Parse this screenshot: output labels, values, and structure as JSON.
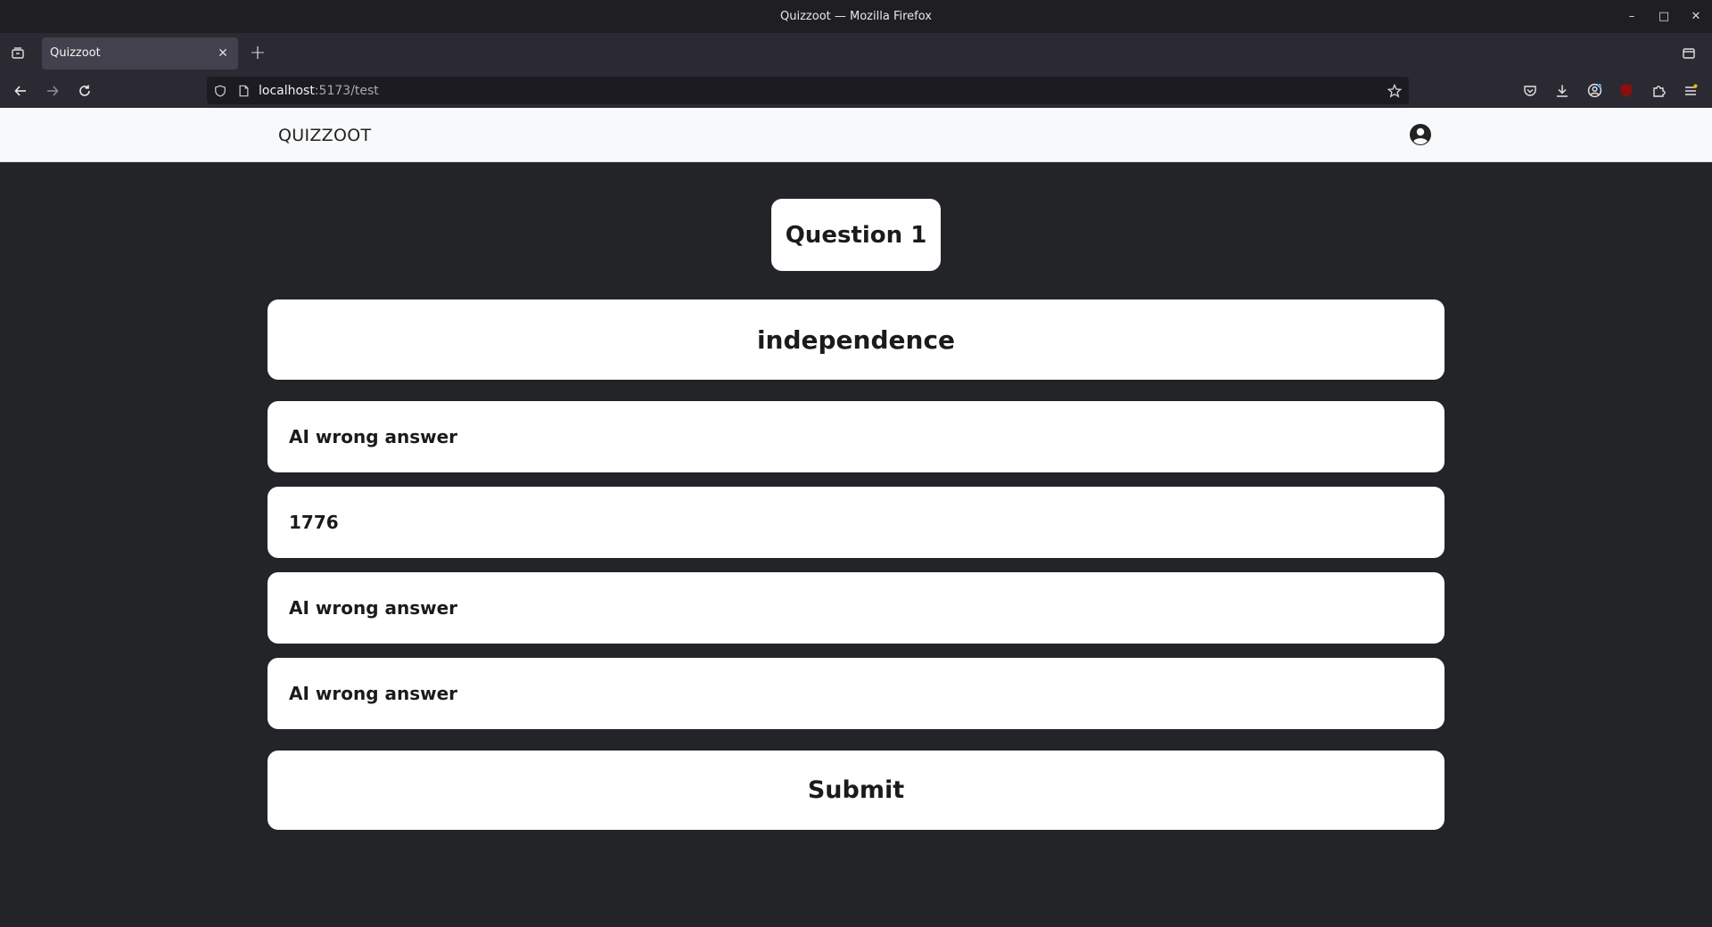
{
  "window": {
    "title": "Quizzoot — Mozilla Firefox",
    "controls": {
      "minimize": "–",
      "maximize": "□",
      "close": "✕"
    }
  },
  "browser": {
    "tab": {
      "title": "Quizzoot",
      "close": "✕"
    },
    "new_tab": "+",
    "url": {
      "host": "localhost",
      "rest": ":5173/test"
    }
  },
  "app": {
    "brand": "QUIZZOOT",
    "question_label": "Question 1",
    "prompt": "independence",
    "answers": [
      {
        "label": "AI wrong answer"
      },
      {
        "label": "1776"
      },
      {
        "label": "AI wrong answer"
      },
      {
        "label": "AI wrong answer"
      }
    ],
    "submit_label": "Submit"
  },
  "colors": {
    "page_background": "#222428",
    "card_background": "#ffffff",
    "header_background": "#f8f9fa",
    "text": "#1b1b1b"
  },
  "icons": {
    "tab_list": "tab-list-icon",
    "back": "back-arrow-icon",
    "forward": "forward-arrow-icon",
    "reload": "reload-icon",
    "shield": "tracking-shield-icon",
    "page": "page-info-icon",
    "bookmark": "bookmark-star-icon",
    "pocket": "pocket-icon",
    "downloads": "downloads-icon",
    "account": "account-icon",
    "ublock": "ublock-icon",
    "extensions": "extensions-icon",
    "menu": "hamburger-menu-icon",
    "profile": "user-profile-icon"
  }
}
